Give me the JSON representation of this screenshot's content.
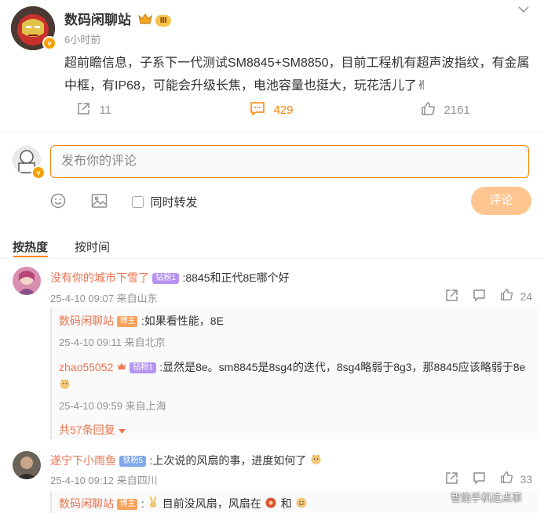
{
  "post": {
    "author": "数码闲聊站",
    "level_badge": "Ⅲ",
    "time": "6小时前",
    "text": "超前瞻信息，子系下一代测试SM8845+SM8850，目前工程机有超声波指纹，有金属中框，有IP68，可能会升级长焦，电池容量也挺大，玩花活儿了✌",
    "repost_count": "11",
    "comment_count": "429",
    "like_count": "2161"
  },
  "compose": {
    "placeholder": "发布你的评论",
    "repost_label": "同时转发",
    "submit_label": "评论"
  },
  "tabs": {
    "hot": "按热度",
    "time": "按时间"
  },
  "comments": [
    {
      "name": "没有你的城市下雪了",
      "badge": "钻粉1",
      "text": ":8845和正代8E哪个好",
      "meta": "25-4-10 09:07 来自山东",
      "likes": "24",
      "replies": [
        {
          "name": "数码闲聊站",
          "badge": "博主",
          "text": ":如果看性能，8E",
          "meta": "25-4-10 09:11 来自北京"
        },
        {
          "name": "zhao55052",
          "badge": "钻粉1",
          "text": ":显然是8e。sm8845是8sg4的迭代，8sg4略弱于8g3，那8845应该略弱于8e",
          "meta": "25-4-10 09:59 来自上海"
        }
      ],
      "more": "共57条回复"
    },
    {
      "name": "遂宁下小雨鱼",
      "badge": "铁粉5",
      "text": ":上次说的风扇的事，进度如何了",
      "meta": "25-4-10 09:12 来自四川",
      "likes": "33",
      "replies": [
        {
          "name": "数码闲聊站",
          "badge": "博主",
          "text_a": "目前没风扇，风扇在",
          "text_b": "和"
        }
      ]
    }
  ],
  "watermark": "智能手机这点事",
  "colors": {
    "accent": "#ff8200",
    "name": "#eb7350"
  }
}
